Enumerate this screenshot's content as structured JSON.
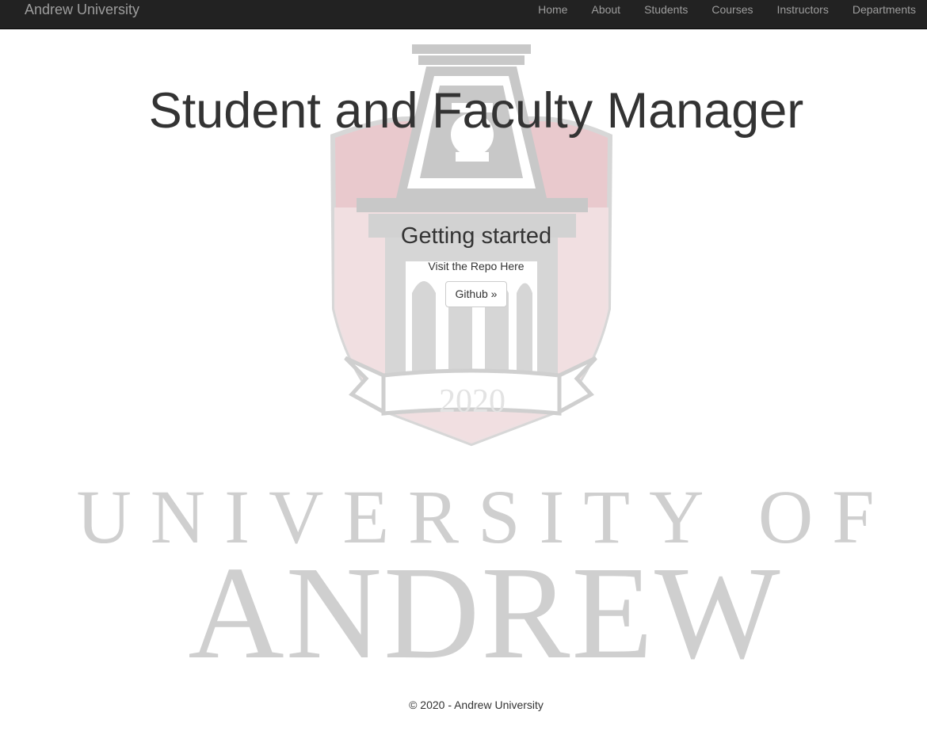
{
  "navbar": {
    "brand": "Andrew University",
    "links": [
      "Home",
      "About",
      "Students",
      "Courses",
      "Instructors",
      "Departments"
    ]
  },
  "hero": {
    "title": "Student and Faculty Manager"
  },
  "getting_started": {
    "heading": "Getting started",
    "text": "Visit the Repo Here",
    "button_label": "Github »"
  },
  "watermark": {
    "year": "2020",
    "line1": "UNIVERSITY OF",
    "line2": "ANDREW",
    "colors": {
      "shield_red": "#e9c9cd",
      "tower_gray": "#c8c8c8",
      "text_gray": "#cfcfcf"
    }
  },
  "footer": {
    "text": "© 2020 - Andrew University"
  },
  "colors": {
    "navbar_bg": "#222222",
    "navbar_text": "#9d9d9d",
    "body_text": "#333333"
  }
}
